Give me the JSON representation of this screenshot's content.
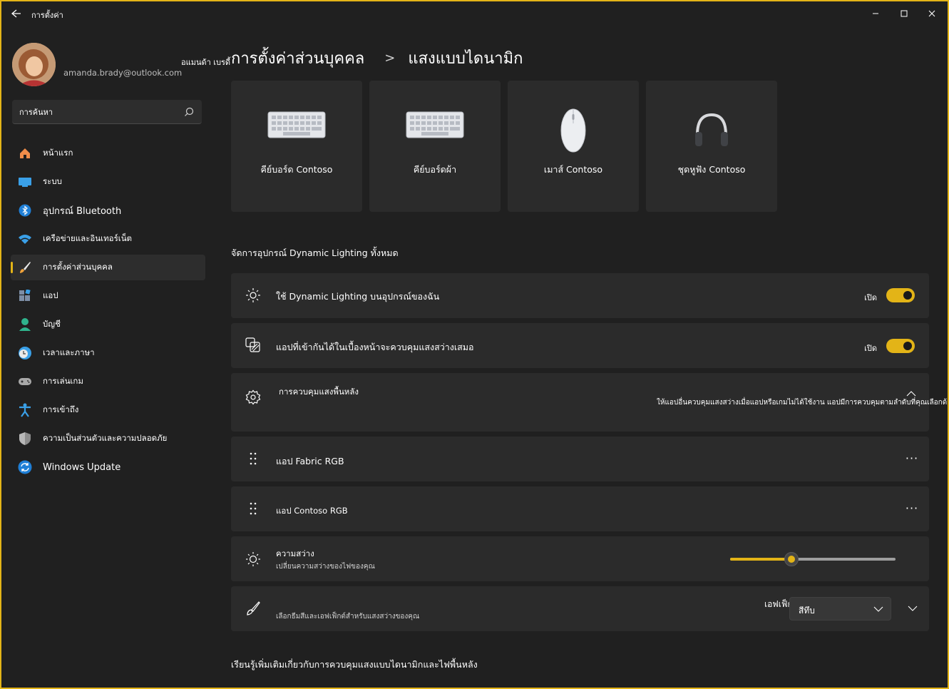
{
  "titlebar": {
    "title": "การตั้งค่า"
  },
  "user": {
    "name": "อแมนด้า เบรดี้",
    "email": "amanda.brady@outlook.com"
  },
  "search": {
    "placeholder": "การค้นหา"
  },
  "nav": {
    "items": [
      {
        "label": "หน้าแรก",
        "icon": "home-icon"
      },
      {
        "label": "ระบบ",
        "icon": "system-icon"
      },
      {
        "label": "อุปกรณ์ Bluetooth",
        "icon": "bluetooth-icon"
      },
      {
        "label": "เครือข่ายและอินเทอร์เน็ต",
        "icon": "wifi-icon"
      },
      {
        "label": "การตั้งค่าส่วนบุคคล",
        "icon": "brush-icon"
      },
      {
        "label": "แอป",
        "icon": "apps-icon"
      },
      {
        "label": "บัญชี",
        "icon": "account-icon"
      },
      {
        "label": "เวลาและภาษา",
        "icon": "clock-globe-icon"
      },
      {
        "label": "การเล่นเกม",
        "icon": "gamepad-icon"
      },
      {
        "label": "การเข้าถึง",
        "icon": "accessibility-icon"
      },
      {
        "label": "ความเป็นส่วนตัวและความปลอดภัย",
        "icon": "shield-icon"
      },
      {
        "label": "Windows Update",
        "icon": "update-icon"
      }
    ],
    "active_index": 4
  },
  "breadcrumb": {
    "parent": "การตั้งค่าส่วนบุคคล",
    "separator": ">",
    "current": "แสงแบบไดนามิก"
  },
  "devices": [
    {
      "label": "คีย์บอร์ด Contoso",
      "icon": "keyboard-icon"
    },
    {
      "label": "คีย์บอร์ดผ้า",
      "icon": "keyboard-icon"
    },
    {
      "label": "เมาส์ Contoso",
      "icon": "mouse-icon"
    },
    {
      "label": "ชุดหูฟัง Contoso",
      "icon": "headset-icon"
    }
  ],
  "section_title": "จัดการอุปกรณ์ Dynamic Lighting ทั้งหมด",
  "settings": {
    "use_dynamic": {
      "label": "ใช้ Dynamic Lighting บนอุปกรณ์ของฉัน",
      "state_text": "เปิด",
      "on": true
    },
    "foreground_apps": {
      "label": "แอปที่เข้ากันได้ในเบื้องหน้าจะควบคุมแสงสว่างเสมอ",
      "state_text": "เปิด",
      "on": true
    },
    "background_control": {
      "label": "การควบคุมแสงพื้นหลัง",
      "description": "ให้แอปอื่นควบคุมแสงสว่างเมื่อแอปหรือเกมไม่ได้ใช้งาน แอปมีการควบคุมตามลำดับที่คุณเลือกด้านล่าง"
    },
    "app_fabric": {
      "label": "แอป Fabric RGB"
    },
    "app_contoso": {
      "label": "แอป Contoso RGB"
    },
    "brightness": {
      "label": "ความสว่าง",
      "sub": "เปลี่ยนความสว่างของไฟของคุณ",
      "value": 0.37
    },
    "effects": {
      "label": "เอฟเฟ็กต์",
      "sub": "เลือกธีมสีและเอฟเฟ็กต์สำหรับแสงสว่างของคุณ",
      "selected": "สีทึบ"
    }
  },
  "more_glyph": "···",
  "learn_more": "เรียนรู้เพิ่มเติมเกี่ยวกับการควบคุมแสงแบบไดนามิกและไฟพื้นหลัง",
  "colors": {
    "accent": "#e3b417",
    "card": "#2b2b2b",
    "background": "#202020"
  }
}
